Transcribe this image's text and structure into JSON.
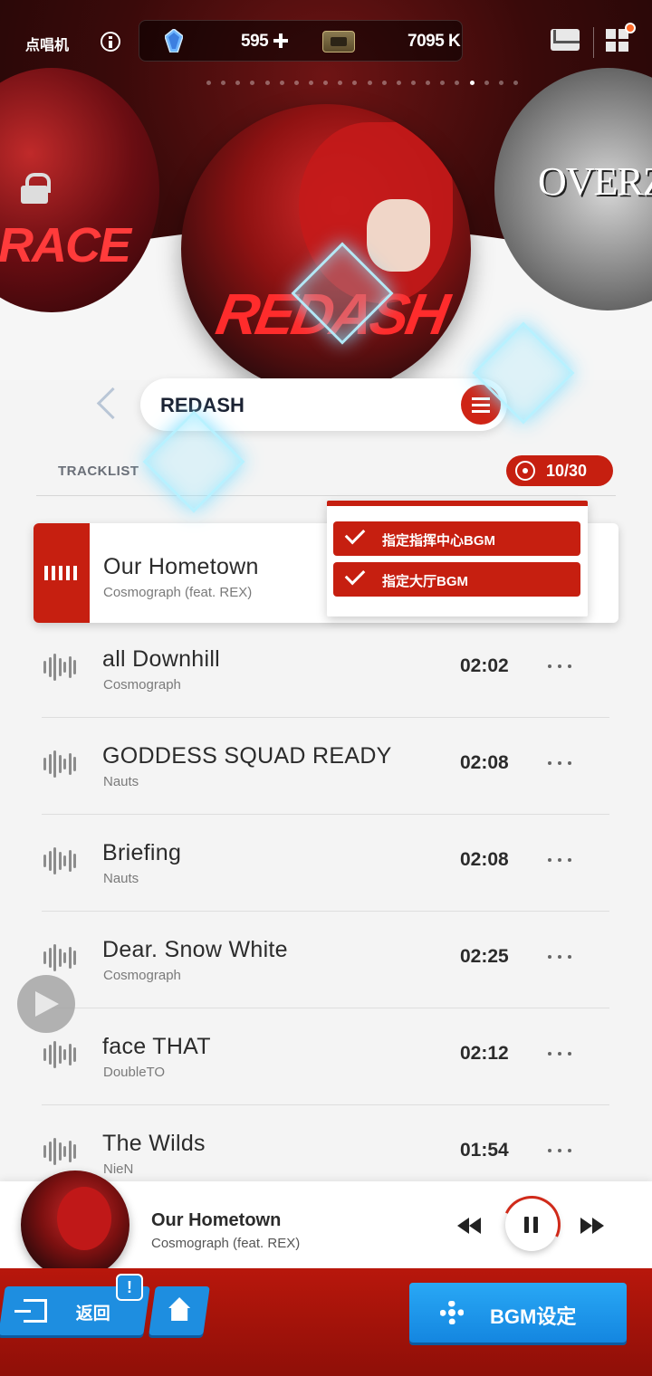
{
  "header": {
    "title": "点唱机",
    "gems": "595",
    "credits": "7095 K",
    "page_count": 22,
    "active_page": 18
  },
  "carousel": {
    "left_album_text": "RACE",
    "center_album_text": "REDASH",
    "right_album_text": "OVERZO"
  },
  "selector": {
    "song_name": "REDASH"
  },
  "tracklist": {
    "label": "TRACKLIST",
    "count": "10/30",
    "selected": {
      "title": "Our Hometown",
      "artist": "Cosmograph (feat. REX)"
    },
    "tracks": [
      {
        "title": "all Downhill",
        "artist": "Cosmograph",
        "duration": "02:02"
      },
      {
        "title": "GODDESS SQUAD READY",
        "artist": "Nauts",
        "duration": "02:08"
      },
      {
        "title": "Briefing",
        "artist": "Nauts",
        "duration": "02:08"
      },
      {
        "title": "Dear. Snow White",
        "artist": "Cosmograph",
        "duration": "02:25"
      },
      {
        "title": "face THAT",
        "artist": "DoubleTO",
        "duration": "02:12"
      },
      {
        "title": "The Wilds",
        "artist": "NieN",
        "duration": "01:54"
      }
    ]
  },
  "bgm_menu": {
    "options": [
      "指定指挥中心BGM",
      "指定大厅BGM"
    ]
  },
  "now_playing": {
    "title": "Our Hometown",
    "artist": "Cosmograph (feat. REX)"
  },
  "bottom_bar": {
    "back_label": "返回",
    "notice": "!",
    "bgm_settings_label": "BGM设定"
  },
  "colors": {
    "accent_red": "#c61f10",
    "button_blue": "#1e8ee0"
  }
}
